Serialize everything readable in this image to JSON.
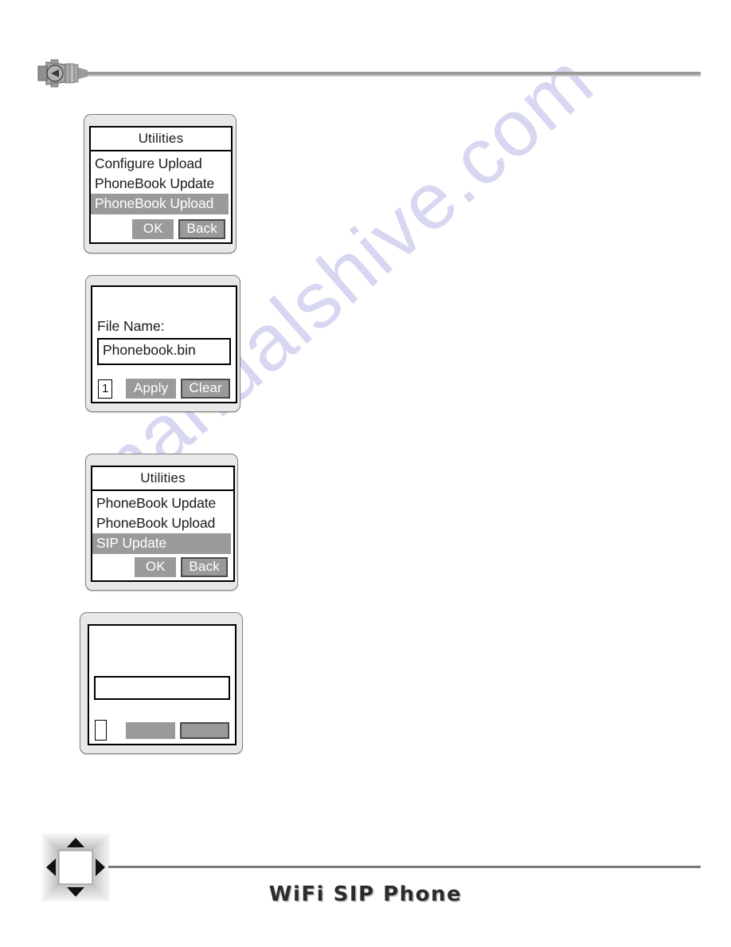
{
  "page": {
    "watermark": "manualshive.com",
    "footer_title": "WiFi SIP Phone"
  },
  "decorations": {
    "top_connector_icon": "cable-connector-icon",
    "top_connector_glyph": "left-triangle-in-circle",
    "bottom_navpad_icon": "dpad-navigation-icon",
    "arrow_up": "triangle-up-icon",
    "arrow_down": "triangle-down-icon",
    "arrow_left": "triangle-left-icon",
    "arrow_right": "triangle-right-icon"
  },
  "panels": [
    {
      "id": "utilities-phonebook-upload",
      "kind": "menu",
      "title": "Utilities",
      "items": [
        {
          "label": "Configure Upload",
          "selected": false
        },
        {
          "label": "PhoneBook Update",
          "selected": false
        },
        {
          "label": "PhoneBook Upload",
          "selected": true
        }
      ],
      "buttons": [
        {
          "label": "OK",
          "style": "solid"
        },
        {
          "label": "Back",
          "style": "framed"
        }
      ]
    },
    {
      "id": "phonebook-filename-form",
      "kind": "form",
      "title": "",
      "field_label": "File Name:",
      "field_value": "Phonebook.bin",
      "page_indicator": "1",
      "buttons": [
        {
          "label": "Apply",
          "style": "solid"
        },
        {
          "label": "Clear",
          "style": "framed"
        }
      ]
    },
    {
      "id": "utilities-sip-update",
      "kind": "menu",
      "title": "Utilities",
      "items": [
        {
          "label": "PhoneBook Update",
          "selected": false
        },
        {
          "label": "PhoneBook Upload",
          "selected": false
        },
        {
          "label": "SIP Update",
          "selected": true
        }
      ],
      "buttons": [
        {
          "label": "OK",
          "style": "solid"
        },
        {
          "label": "Back",
          "style": "framed"
        }
      ]
    },
    {
      "id": "blank-filename-form",
      "kind": "form",
      "title": "",
      "field_label": "",
      "field_value": "",
      "page_indicator": "",
      "buttons": [
        {
          "label": "",
          "style": "solid"
        },
        {
          "label": "",
          "style": "framed"
        }
      ]
    }
  ],
  "colors": {
    "lcd_frame": "#e8e8e8",
    "lcd_border": "#808080",
    "screen_bg": "#ffffff",
    "ink": "#1a1a1a",
    "highlight_bg": "#9a9a9a",
    "highlight_fg": "#ffffff",
    "rule": "#7a7a7a",
    "watermark": "#d7d7f2"
  }
}
